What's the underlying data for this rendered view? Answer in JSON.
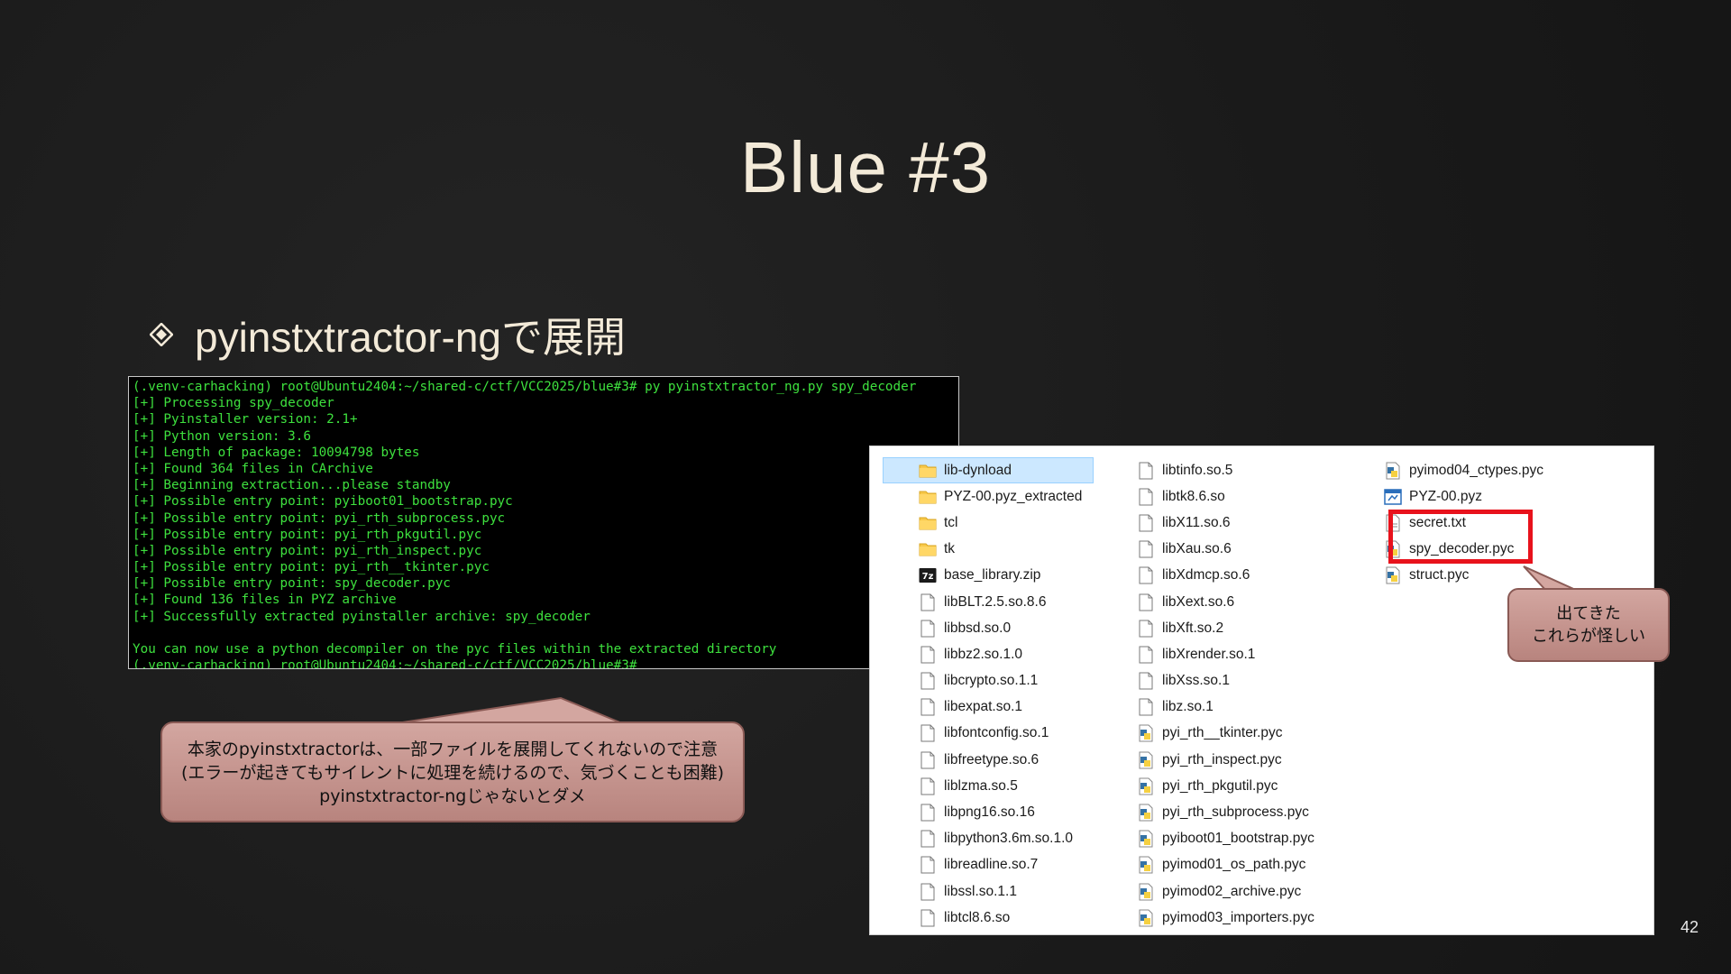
{
  "slide": {
    "title": "Blue #3",
    "bullet": "pyinstxtractor-ngで展開",
    "page_number": "42"
  },
  "terminal": {
    "lines": [
      "(.venv-carhacking) root@Ubuntu2404:~/shared-c/ctf/VCC2025/blue#3# py pyinstxtractor_ng.py spy_decoder",
      "[+] Processing spy_decoder",
      "[+] Pyinstaller version: 2.1+",
      "[+] Python version: 3.6",
      "[+] Length of package: 10094798 bytes",
      "[+] Found 364 files in CArchive",
      "[+] Beginning extraction...please standby",
      "[+] Possible entry point: pyiboot01_bootstrap.pyc",
      "[+] Possible entry point: pyi_rth_subprocess.pyc",
      "[+] Possible entry point: pyi_rth_pkgutil.pyc",
      "[+] Possible entry point: pyi_rth_inspect.pyc",
      "[+] Possible entry point: pyi_rth__tkinter.pyc",
      "[+] Possible entry point: spy_decoder.pyc",
      "[+] Found 136 files in PYZ archive",
      "[+] Successfully extracted pyinstaller archive: spy_decoder",
      "",
      "You can now use a python decompiler on the pyc files within the extracted directory",
      "(.venv-carhacking) root@Ubuntu2404:~/shared-c/ctf/VCC2025/blue#3#"
    ]
  },
  "explorer": {
    "columns": [
      [
        {
          "name": "lib-dynload",
          "icon": "folder-icon",
          "selected": true
        },
        {
          "name": "PYZ-00.pyz_extracted",
          "icon": "folder-icon"
        },
        {
          "name": "tcl",
          "icon": "folder-icon"
        },
        {
          "name": "tk",
          "icon": "folder-icon"
        },
        {
          "name": "base_library.zip",
          "icon": "zip-icon"
        },
        {
          "name": "libBLT.2.5.so.8.6",
          "icon": "file-icon"
        },
        {
          "name": "libbsd.so.0",
          "icon": "file-icon"
        },
        {
          "name": "libbz2.so.1.0",
          "icon": "file-icon"
        },
        {
          "name": "libcrypto.so.1.1",
          "icon": "file-icon"
        },
        {
          "name": "libexpat.so.1",
          "icon": "file-icon"
        },
        {
          "name": "libfontconfig.so.1",
          "icon": "file-icon"
        },
        {
          "name": "libfreetype.so.6",
          "icon": "file-icon"
        },
        {
          "name": "liblzma.so.5",
          "icon": "file-icon"
        },
        {
          "name": "libpng16.so.16",
          "icon": "file-icon"
        },
        {
          "name": "libpython3.6m.so.1.0",
          "icon": "file-icon"
        },
        {
          "name": "libreadline.so.7",
          "icon": "file-icon"
        },
        {
          "name": "libssl.so.1.1",
          "icon": "file-icon"
        },
        {
          "name": "libtcl8.6.so",
          "icon": "file-icon"
        }
      ],
      [
        {
          "name": "libtinfo.so.5",
          "icon": "file-icon"
        },
        {
          "name": "libtk8.6.so",
          "icon": "file-icon"
        },
        {
          "name": "libX11.so.6",
          "icon": "file-icon"
        },
        {
          "name": "libXau.so.6",
          "icon": "file-icon"
        },
        {
          "name": "libXdmcp.so.6",
          "icon": "file-icon"
        },
        {
          "name": "libXext.so.6",
          "icon": "file-icon"
        },
        {
          "name": "libXft.so.2",
          "icon": "file-icon"
        },
        {
          "name": "libXrender.so.1",
          "icon": "file-icon"
        },
        {
          "name": "libXss.so.1",
          "icon": "file-icon"
        },
        {
          "name": "libz.so.1",
          "icon": "file-icon"
        },
        {
          "name": "pyi_rth__tkinter.pyc",
          "icon": "python-file-icon"
        },
        {
          "name": "pyi_rth_inspect.pyc",
          "icon": "python-file-icon"
        },
        {
          "name": "pyi_rth_pkgutil.pyc",
          "icon": "python-file-icon"
        },
        {
          "name": "pyi_rth_subprocess.pyc",
          "icon": "python-file-icon"
        },
        {
          "name": "pyiboot01_bootstrap.pyc",
          "icon": "python-file-icon"
        },
        {
          "name": "pyimod01_os_path.pyc",
          "icon": "python-file-icon"
        },
        {
          "name": "pyimod02_archive.pyc",
          "icon": "python-file-icon"
        },
        {
          "name": "pyimod03_importers.pyc",
          "icon": "python-file-icon"
        }
      ],
      [
        {
          "name": "pyimod04_ctypes.pyc",
          "icon": "python-file-icon"
        },
        {
          "name": "PYZ-00.pyz",
          "icon": "pyz-file-icon"
        },
        {
          "name": "secret.txt",
          "icon": "text-file-icon"
        },
        {
          "name": "spy_decoder.pyc",
          "icon": "python-file-icon"
        },
        {
          "name": "struct.pyc",
          "icon": "python-file-icon"
        }
      ]
    ]
  },
  "callouts": {
    "right": [
      "出てきた",
      "これらが怪しい"
    ],
    "left": [
      "本家のpyinstxtractorは、一部ファイルを展開してくれないので注意",
      "(エラーが起きてもサイレントに処理を続けるので、気づくことも困難)",
      "pyinstxtractor-ngじゃないとダメ"
    ]
  },
  "colors": {
    "terminal_text": "#3ee13e",
    "highlight_box": "#e8121c",
    "callout_fill": "#c79892",
    "title_text": "#f3ead8"
  }
}
